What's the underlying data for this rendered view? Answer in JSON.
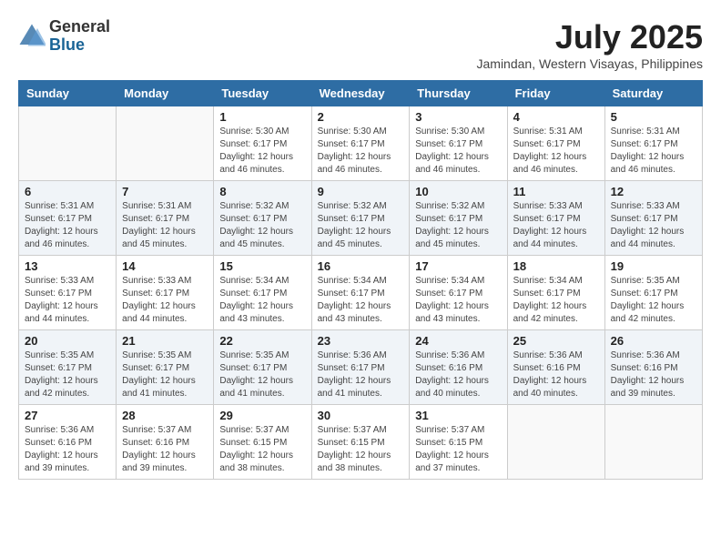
{
  "logo": {
    "general": "General",
    "blue": "Blue"
  },
  "title": "July 2025",
  "location": "Jamindan, Western Visayas, Philippines",
  "days_of_week": [
    "Sunday",
    "Monday",
    "Tuesday",
    "Wednesday",
    "Thursday",
    "Friday",
    "Saturday"
  ],
  "weeks": [
    [
      {
        "day": "",
        "info": ""
      },
      {
        "day": "",
        "info": ""
      },
      {
        "day": "1",
        "info": "Sunrise: 5:30 AM\nSunset: 6:17 PM\nDaylight: 12 hours and 46 minutes."
      },
      {
        "day": "2",
        "info": "Sunrise: 5:30 AM\nSunset: 6:17 PM\nDaylight: 12 hours and 46 minutes."
      },
      {
        "day": "3",
        "info": "Sunrise: 5:30 AM\nSunset: 6:17 PM\nDaylight: 12 hours and 46 minutes."
      },
      {
        "day": "4",
        "info": "Sunrise: 5:31 AM\nSunset: 6:17 PM\nDaylight: 12 hours and 46 minutes."
      },
      {
        "day": "5",
        "info": "Sunrise: 5:31 AM\nSunset: 6:17 PM\nDaylight: 12 hours and 46 minutes."
      }
    ],
    [
      {
        "day": "6",
        "info": "Sunrise: 5:31 AM\nSunset: 6:17 PM\nDaylight: 12 hours and 46 minutes."
      },
      {
        "day": "7",
        "info": "Sunrise: 5:31 AM\nSunset: 6:17 PM\nDaylight: 12 hours and 45 minutes."
      },
      {
        "day": "8",
        "info": "Sunrise: 5:32 AM\nSunset: 6:17 PM\nDaylight: 12 hours and 45 minutes."
      },
      {
        "day": "9",
        "info": "Sunrise: 5:32 AM\nSunset: 6:17 PM\nDaylight: 12 hours and 45 minutes."
      },
      {
        "day": "10",
        "info": "Sunrise: 5:32 AM\nSunset: 6:17 PM\nDaylight: 12 hours and 45 minutes."
      },
      {
        "day": "11",
        "info": "Sunrise: 5:33 AM\nSunset: 6:17 PM\nDaylight: 12 hours and 44 minutes."
      },
      {
        "day": "12",
        "info": "Sunrise: 5:33 AM\nSunset: 6:17 PM\nDaylight: 12 hours and 44 minutes."
      }
    ],
    [
      {
        "day": "13",
        "info": "Sunrise: 5:33 AM\nSunset: 6:17 PM\nDaylight: 12 hours and 44 minutes."
      },
      {
        "day": "14",
        "info": "Sunrise: 5:33 AM\nSunset: 6:17 PM\nDaylight: 12 hours and 44 minutes."
      },
      {
        "day": "15",
        "info": "Sunrise: 5:34 AM\nSunset: 6:17 PM\nDaylight: 12 hours and 43 minutes."
      },
      {
        "day": "16",
        "info": "Sunrise: 5:34 AM\nSunset: 6:17 PM\nDaylight: 12 hours and 43 minutes."
      },
      {
        "day": "17",
        "info": "Sunrise: 5:34 AM\nSunset: 6:17 PM\nDaylight: 12 hours and 43 minutes."
      },
      {
        "day": "18",
        "info": "Sunrise: 5:34 AM\nSunset: 6:17 PM\nDaylight: 12 hours and 42 minutes."
      },
      {
        "day": "19",
        "info": "Sunrise: 5:35 AM\nSunset: 6:17 PM\nDaylight: 12 hours and 42 minutes."
      }
    ],
    [
      {
        "day": "20",
        "info": "Sunrise: 5:35 AM\nSunset: 6:17 PM\nDaylight: 12 hours and 42 minutes."
      },
      {
        "day": "21",
        "info": "Sunrise: 5:35 AM\nSunset: 6:17 PM\nDaylight: 12 hours and 41 minutes."
      },
      {
        "day": "22",
        "info": "Sunrise: 5:35 AM\nSunset: 6:17 PM\nDaylight: 12 hours and 41 minutes."
      },
      {
        "day": "23",
        "info": "Sunrise: 5:36 AM\nSunset: 6:17 PM\nDaylight: 12 hours and 41 minutes."
      },
      {
        "day": "24",
        "info": "Sunrise: 5:36 AM\nSunset: 6:16 PM\nDaylight: 12 hours and 40 minutes."
      },
      {
        "day": "25",
        "info": "Sunrise: 5:36 AM\nSunset: 6:16 PM\nDaylight: 12 hours and 40 minutes."
      },
      {
        "day": "26",
        "info": "Sunrise: 5:36 AM\nSunset: 6:16 PM\nDaylight: 12 hours and 39 minutes."
      }
    ],
    [
      {
        "day": "27",
        "info": "Sunrise: 5:36 AM\nSunset: 6:16 PM\nDaylight: 12 hours and 39 minutes."
      },
      {
        "day": "28",
        "info": "Sunrise: 5:37 AM\nSunset: 6:16 PM\nDaylight: 12 hours and 39 minutes."
      },
      {
        "day": "29",
        "info": "Sunrise: 5:37 AM\nSunset: 6:15 PM\nDaylight: 12 hours and 38 minutes."
      },
      {
        "day": "30",
        "info": "Sunrise: 5:37 AM\nSunset: 6:15 PM\nDaylight: 12 hours and 38 minutes."
      },
      {
        "day": "31",
        "info": "Sunrise: 5:37 AM\nSunset: 6:15 PM\nDaylight: 12 hours and 37 minutes."
      },
      {
        "day": "",
        "info": ""
      },
      {
        "day": "",
        "info": ""
      }
    ]
  ]
}
